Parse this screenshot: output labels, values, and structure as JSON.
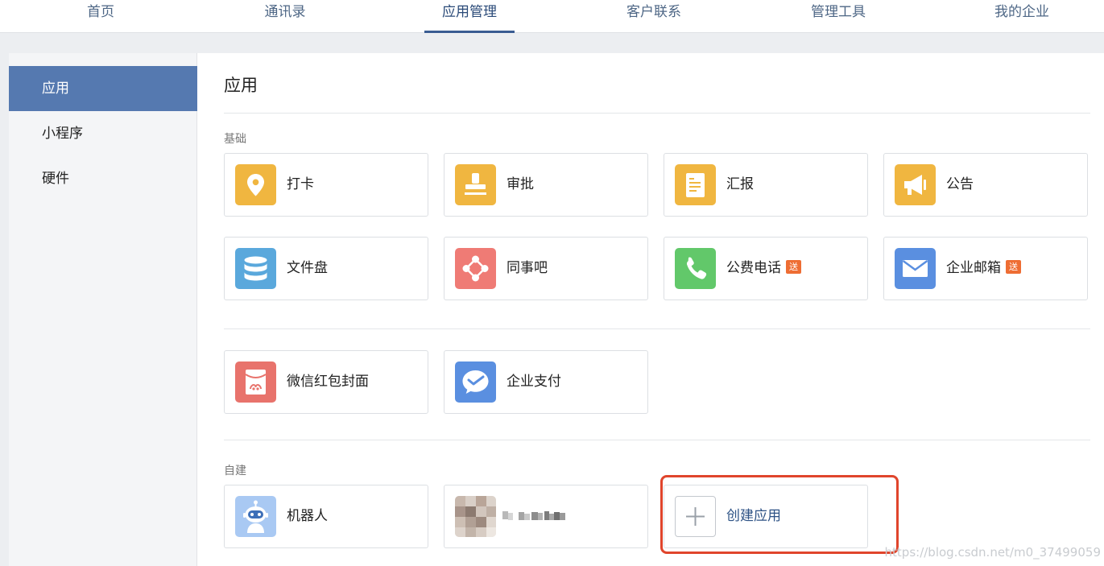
{
  "topnav": {
    "tabs": [
      {
        "label": "首页"
      },
      {
        "label": "通讯录"
      },
      {
        "label": "应用管理"
      },
      {
        "label": "客户联系"
      },
      {
        "label": "管理工具"
      },
      {
        "label": "我的企业"
      }
    ],
    "active_tab": "应用管理"
  },
  "sidebar": {
    "items": [
      {
        "label": "应用"
      },
      {
        "label": "小程序"
      },
      {
        "label": "硬件"
      }
    ],
    "active_item": "应用"
  },
  "main": {
    "title": "应用",
    "basic": {
      "label": "基础",
      "apps": [
        {
          "label": "打卡",
          "icon": "location-pin-icon"
        },
        {
          "label": "审批",
          "icon": "stamp-icon"
        },
        {
          "label": "汇报",
          "icon": "document-icon"
        },
        {
          "label": "公告",
          "icon": "megaphone-icon"
        },
        {
          "label": "文件盘",
          "icon": "database-icon"
        },
        {
          "label": "同事吧",
          "icon": "network-icon"
        },
        {
          "label": "公费电话",
          "icon": "phone-icon",
          "badge": "送"
        },
        {
          "label": "企业邮箱",
          "icon": "envelope-icon",
          "badge": "送"
        }
      ]
    },
    "extra": {
      "apps": [
        {
          "label": "微信红包封面",
          "icon": "red-packet-icon"
        },
        {
          "label": "企业支付",
          "icon": "pay-icon"
        }
      ]
    },
    "custom": {
      "label": "自建",
      "apps": [
        {
          "label": "机器人",
          "icon": "robot-icon"
        },
        {
          "label": "",
          "icon": "blurred-app-icon"
        },
        {
          "label": "创建应用",
          "icon": "plus-icon"
        }
      ]
    }
  },
  "watermark": "https://blog.csdn.net/m0_37499059",
  "colors": {
    "accent": "#5579b0",
    "highlight": "#e0452c",
    "badge": "#ee6d33",
    "yellow": "#f0b640",
    "blue": "#5a8fd6",
    "green": "#62c86a",
    "red": "#ef7b75"
  }
}
